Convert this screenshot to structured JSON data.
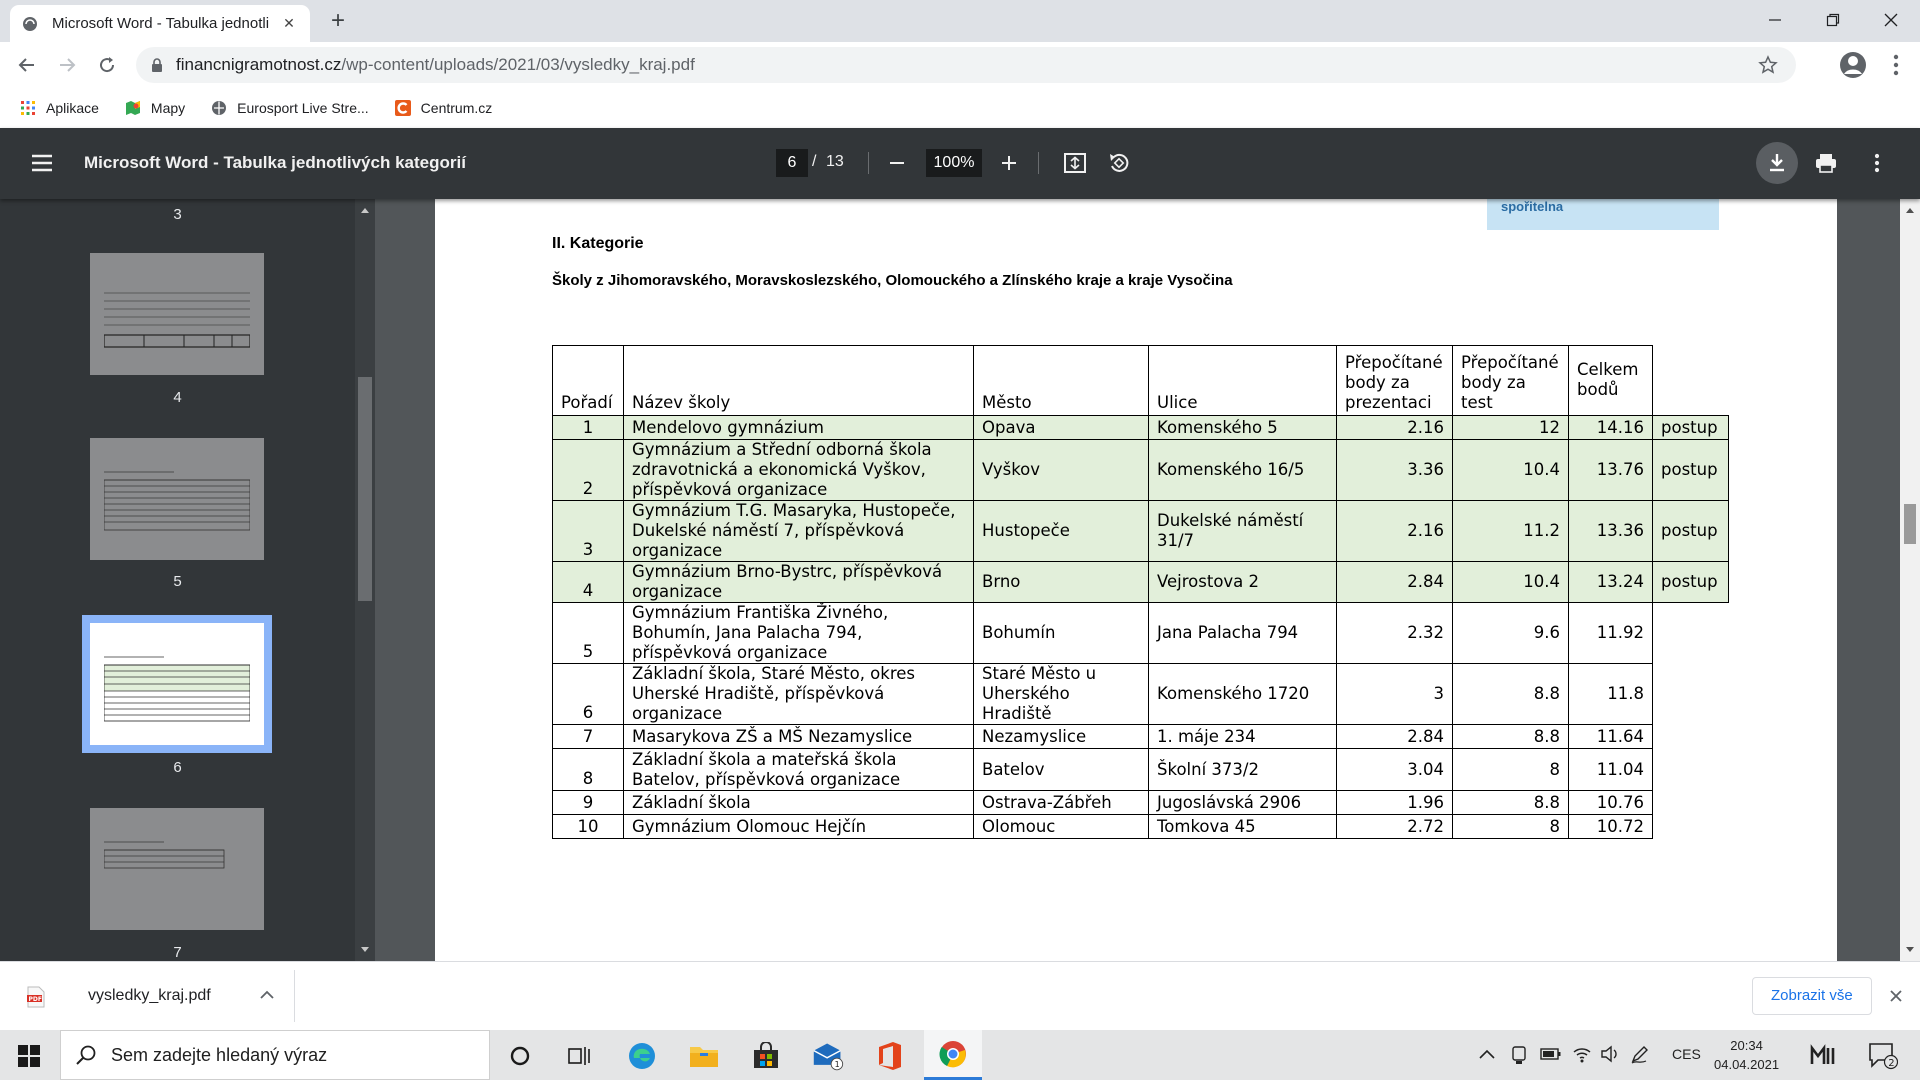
{
  "browser": {
    "tab_title": "Microsoft Word - Tabulka jednotli",
    "url_host": "financnigramotnost.cz",
    "url_path": "/wp-content/uploads/2021/03/vysledky_kraj.pdf",
    "bookmarks": [
      "Aplikace",
      "Mapy",
      "Eurosport Live Stre...",
      "Centrum.cz"
    ]
  },
  "pdf_toolbar": {
    "doc_title": "Microsoft Word - Tabulka jednotlivých kategorií",
    "current_page": "6",
    "page_sep": "/",
    "total_pages": "13",
    "zoom": "100%"
  },
  "sidebar": {
    "thumb_labels": [
      "3",
      "4",
      "5",
      "6",
      "7"
    ],
    "active_page": "6"
  },
  "page": {
    "logo_text": "spořitelna",
    "category_title": "II. Kategorie",
    "category_subtitle": "Školy z Jihomoravského, Moravskoslezského, Olomouckého a Zlínského kraje a kraje Vysočina",
    "table": {
      "headers": {
        "rank": "Pořadí",
        "school": "Název školy",
        "city": "Město",
        "street": "Ulice",
        "pres_l1": "Přepočítané",
        "pres_l2": "body za",
        "pres_l3": "prezentaci",
        "test_l1": "Přepočítané",
        "test_l2": "body za",
        "test_l3": "test",
        "total_l1": "Celkem",
        "total_l2": "bodů"
      },
      "rows": [
        {
          "rank": "1",
          "school": "Mendelovo gymnázium",
          "city": "Opava",
          "street": "Komenského 5",
          "pres": "2.16",
          "test": "12",
          "total": "14.16",
          "note": "postup"
        },
        {
          "rank": "2",
          "school": "Gymnázium a Střední odborná škola zdravotnická a ekonomická Vyškov, příspěvková organizace",
          "city": "Vyškov",
          "street": "Komenského 16/5",
          "pres": "3.36",
          "test": "10.4",
          "total": "13.76",
          "note": "postup"
        },
        {
          "rank": "3",
          "school": "Gymnázium T.G. Masaryka, Hustopeče, Dukelské náměstí 7, příspěvková organizace",
          "city": "Hustopeče",
          "street": "Dukelské náměstí 31/7",
          "pres": "2.16",
          "test": "11.2",
          "total": "13.36",
          "note": "postup"
        },
        {
          "rank": "4",
          "school": "Gymnázium Brno-Bystrc, příspěvková organizace",
          "city": "Brno",
          "street": "Vejrostova 2",
          "pres": "2.84",
          "test": "10.4",
          "total": "13.24",
          "note": "postup"
        },
        {
          "rank": "5",
          "school": "Gymnázium Františka Živného, Bohumín, Jana Palacha 794, příspěvková organizace",
          "city": "Bohumín",
          "street": "Jana Palacha 794",
          "pres": "2.32",
          "test": "9.6",
          "total": "11.92",
          "note": ""
        },
        {
          "rank": "6",
          "school": "Základní škola, Staré Město, okres Uherské Hradiště, příspěvková organizace",
          "city": "Staré Město u Uherského Hradiště",
          "street": "Komenského 1720",
          "pres": "3",
          "test": "8.8",
          "total": "11.8",
          "note": ""
        },
        {
          "rank": "7",
          "school": "Masarykova ZŠ a MŠ Nezamyslice",
          "city": "Nezamyslice",
          "street": "1. máje 234",
          "pres": "2.84",
          "test": "8.8",
          "total": "11.64",
          "note": ""
        },
        {
          "rank": "8",
          "school": "Základní škola a mateřská škola Batelov, příspěvková organizace",
          "city": "Batelov",
          "street": "Školní 373/2",
          "pres": "3.04",
          "test": "8",
          "total": "11.04",
          "note": ""
        },
        {
          "rank": "9",
          "school": "Základní škola",
          "city": "Ostrava-Zábřeh",
          "street": "Jugoslávská 2906",
          "pres": "1.96",
          "test": "8.8",
          "total": "10.76",
          "note": ""
        },
        {
          "rank": "10",
          "school": "Gymnázium Olomouc Hejčín",
          "city": "Olomouc",
          "street": "Tomkova 45",
          "pres": "2.72",
          "test": "8",
          "total": "10.72",
          "note": ""
        }
      ]
    }
  },
  "download_bar": {
    "file_name": "vysledky_kraj.pdf",
    "show_all": "Zobrazit vše"
  },
  "taskbar": {
    "search_placeholder": "Sem zadejte hledaný výraz",
    "mail_badge": "1",
    "lang": "CES",
    "time": "20:34",
    "date": "04.04.2021",
    "notif_count": "2"
  },
  "colors": {
    "pdf_toolbar_bg": "#323639",
    "viewer_bg": "#525659",
    "advancing_row_bg": "#e2efda",
    "thumb_selected_frame": "#8ab4f8",
    "link_blue": "#1a73e8"
  }
}
